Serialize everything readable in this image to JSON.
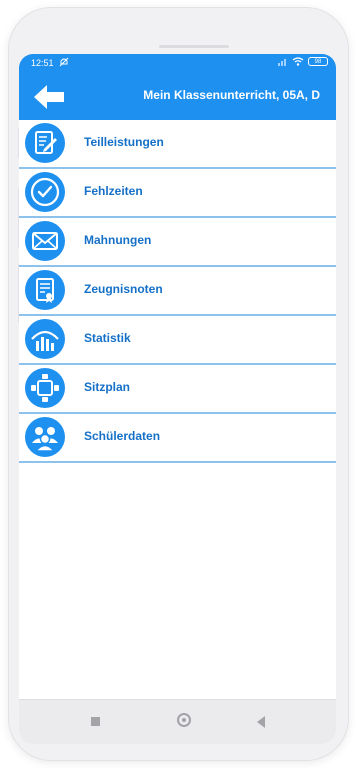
{
  "statusbar": {
    "time": "12:51",
    "battery": "98"
  },
  "appbar": {
    "title": "Mein Klassenunterricht, 05A, D"
  },
  "menu": {
    "items": [
      {
        "label": "Teilleistungen",
        "icon": "edit-document-icon"
      },
      {
        "label": "Fehlzeiten",
        "icon": "clock-check-icon"
      },
      {
        "label": "Mahnungen",
        "icon": "envelope-icon"
      },
      {
        "label": "Zeugnisnoten",
        "icon": "certificate-icon"
      },
      {
        "label": "Statistik",
        "icon": "statistics-chart-icon"
      },
      {
        "label": "Sitzplan",
        "icon": "seating-plan-icon"
      },
      {
        "label": "Schülerdaten",
        "icon": "students-group-icon"
      }
    ]
  },
  "colors": {
    "primary": "#1e90f0",
    "label": "#1570c8",
    "divider": "#8cc2ec"
  }
}
